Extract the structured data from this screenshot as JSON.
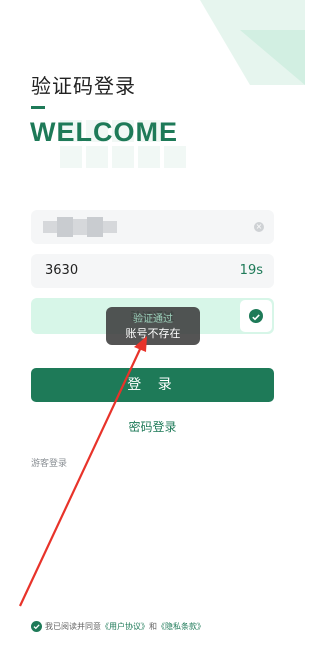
{
  "page": {
    "title": "验证码登录",
    "welcome": "WELCOME"
  },
  "phone_field": {
    "value_obscured": true,
    "clear_icon": "clear-icon"
  },
  "code_field": {
    "value": "3630",
    "countdown": "19s"
  },
  "verify": {
    "status": "验证通过",
    "icon": "check-icon"
  },
  "toast": {
    "message": "账号不存在"
  },
  "buttons": {
    "login": "登 录",
    "password_login": "密码登录",
    "guest_login": "游客登录"
  },
  "agreement": {
    "checked": true,
    "prefix": "我已阅读并同意",
    "user_agreement": "《用户协议》",
    "and": "和",
    "privacy_policy": "《隐私条款》"
  },
  "colors": {
    "accent": "#1e7a58",
    "verify_bg": "#d7f6e8",
    "annotation_arrow": "#e8332a"
  }
}
